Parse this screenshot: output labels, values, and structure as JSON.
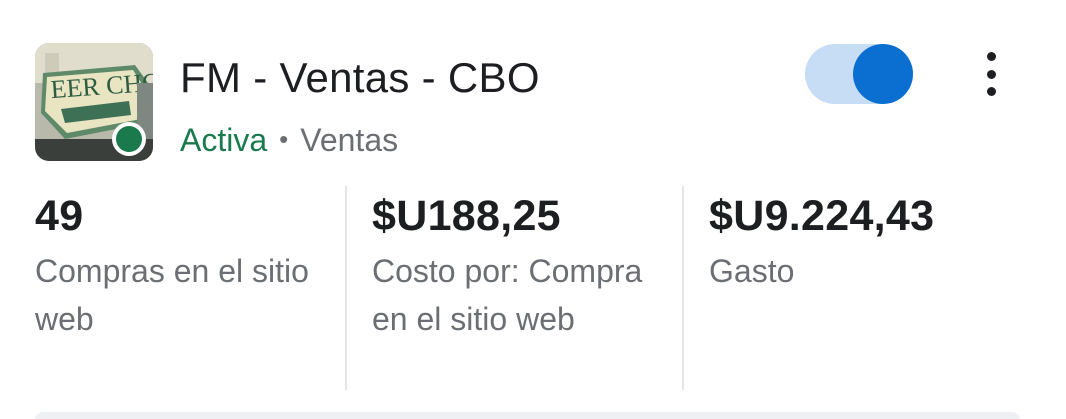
{
  "campaign": {
    "thumbnail_icon": "campaign-thumbnail-image",
    "thumbnail_text": "BEER CHO",
    "name": "FM - Ventas - CBO",
    "status": "Activa",
    "separator": "•",
    "objective": "Ventas",
    "status_color": "#1a7a4d",
    "toggle_on": true,
    "toggle_color": "#0a6fd0",
    "more_icon": "more-vertical-icon"
  },
  "metrics": [
    {
      "value": "49",
      "label": "Compras en el sitio web"
    },
    {
      "value": "$U188,25",
      "label": "Costo por: Compra en el sitio web"
    },
    {
      "value": "$U9.224,43",
      "label": "Gasto"
    }
  ]
}
